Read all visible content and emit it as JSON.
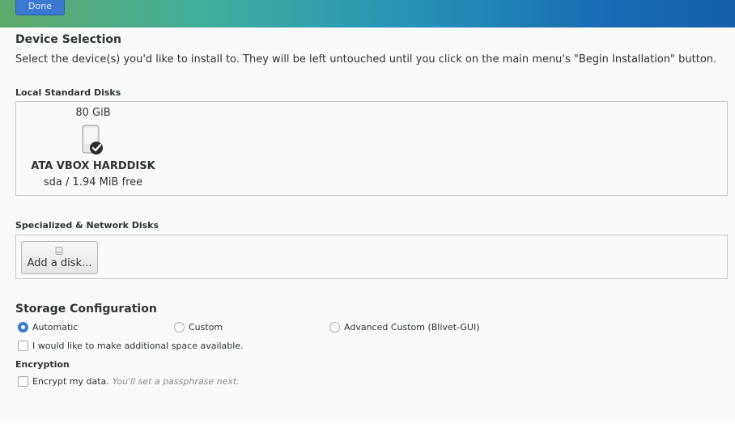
{
  "header": {
    "done_label": "Done"
  },
  "device_selection": {
    "title": "Device Selection",
    "intro": "Select the device(s) you'd like to install to.  They will be left untouched until you click on the main menu's \"Begin Installation\" button."
  },
  "local_disks": {
    "label": "Local Standard Disks",
    "disks": [
      {
        "size": "80 GiB",
        "name": "ATA VBOX HARDDISK",
        "device": "sda",
        "separator": "/",
        "free": "1.94 MiB free",
        "selected": true
      }
    ]
  },
  "network_disks": {
    "label": "Specialized & Network Disks",
    "add_button_label": "Add a disk..."
  },
  "storage_config": {
    "title": "Storage Configuration",
    "options": [
      {
        "label": "Automatic",
        "selected": true
      },
      {
        "label": "Custom",
        "selected": false
      },
      {
        "label": "Advanced Custom (Blivet-GUI)",
        "selected": false
      }
    ],
    "extra_space_label": "I would like to make additional space available."
  },
  "encryption": {
    "title": "Encryption",
    "encrypt_label": "Encrypt my data.",
    "encrypt_hint": "You'll set a passphrase next."
  },
  "colors": {
    "accent": "#3a7ad0"
  }
}
